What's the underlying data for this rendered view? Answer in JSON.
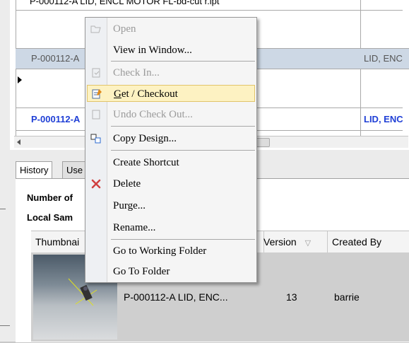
{
  "grid": {
    "top_row_text": "P-000112-A LID, ENCL MOTOR FL-bd-cut r.ipt",
    "row_selected_part": "P-000112-A",
    "row_selected_desc": "LID, ENC",
    "row_blue_part": "P-000112-A",
    "row_blue_desc": "LID, ENC",
    "colors": {
      "selected_row": "#cdd8e5",
      "blue_text": "#1f3fd6"
    }
  },
  "tabs": [
    {
      "label": "History"
    },
    {
      "label": "Use"
    }
  ],
  "info": {
    "number_label": "Number of",
    "local_label": "Local Sam"
  },
  "table": {
    "headers": {
      "thumbnail": "Thumbnai",
      "version": "Version",
      "created_by": "Created By"
    },
    "sort_glyph": "▽",
    "row": {
      "name": "P-000112-A LID, ENC...",
      "version": "13",
      "created_by": "barrie"
    }
  },
  "menu": {
    "open": "Open",
    "view_in_window": "View in Window...",
    "check_in": "Check In...",
    "get_checkout": "Get / Checkout",
    "undo_check_out": "Undo Check Out...",
    "copy_design": "Copy Design...",
    "create_shortcut": "Create Shortcut",
    "delete": "Delete",
    "purge": "Purge...",
    "rename": "Rename...",
    "go_to_working_folder": "Go to Working Folder",
    "go_to_folder": "Go To Folder"
  }
}
